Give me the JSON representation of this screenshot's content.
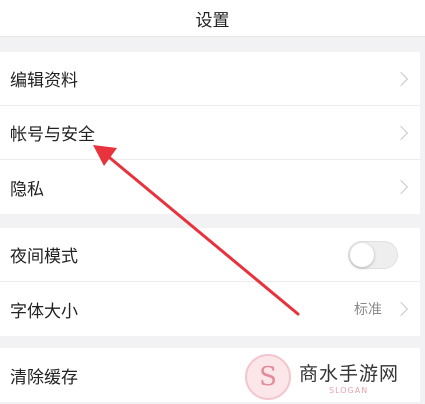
{
  "header": {
    "title": "设置"
  },
  "account_group": {
    "items": [
      {
        "label": "编辑资料"
      },
      {
        "label": "帐号与安全"
      },
      {
        "label": "隐私"
      }
    ]
  },
  "display_group": {
    "night_mode": {
      "label": "夜间模式",
      "enabled": false
    },
    "font_size": {
      "label": "字体大小",
      "value": "标准"
    }
  },
  "storage_group": {
    "clear_cache": {
      "label": "清除缓存"
    }
  },
  "watermark": {
    "title": "商水手游网",
    "subtitle": "SLOGAN",
    "logo_glyph": "S"
  },
  "colors": {
    "arrow": "#e8323c",
    "background": "#f2f2f4"
  },
  "icons": [
    "chevron-right-icon",
    "toggle-switch",
    "pointer-arrow"
  ]
}
